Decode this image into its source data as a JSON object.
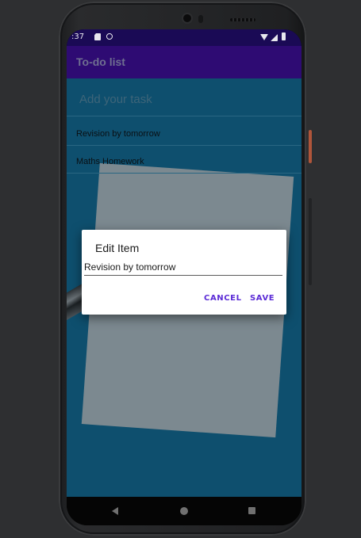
{
  "status_bar": {
    "time": ":37"
  },
  "app_bar": {
    "title": "To-do list"
  },
  "task_input": {
    "placeholder": "Add your task"
  },
  "list": {
    "items": [
      {
        "label": "Revision by tomorrow"
      },
      {
        "label": "Maths Homework"
      }
    ]
  },
  "dialog": {
    "title": "Edit Item",
    "field_value": "Revision by tomorrow",
    "cancel_label": "CANCEL",
    "save_label": "SAVE"
  },
  "colors": {
    "app_bar": "#2e0b73",
    "status_bar": "#1a0a55",
    "accent": "#5b2bd6"
  },
  "icons": {
    "status": [
      "sim-card-icon",
      "sync-icon",
      "wifi-icon",
      "signal-icon",
      "battery-icon"
    ],
    "nav": [
      "back-icon",
      "home-icon",
      "recents-icon"
    ]
  }
}
